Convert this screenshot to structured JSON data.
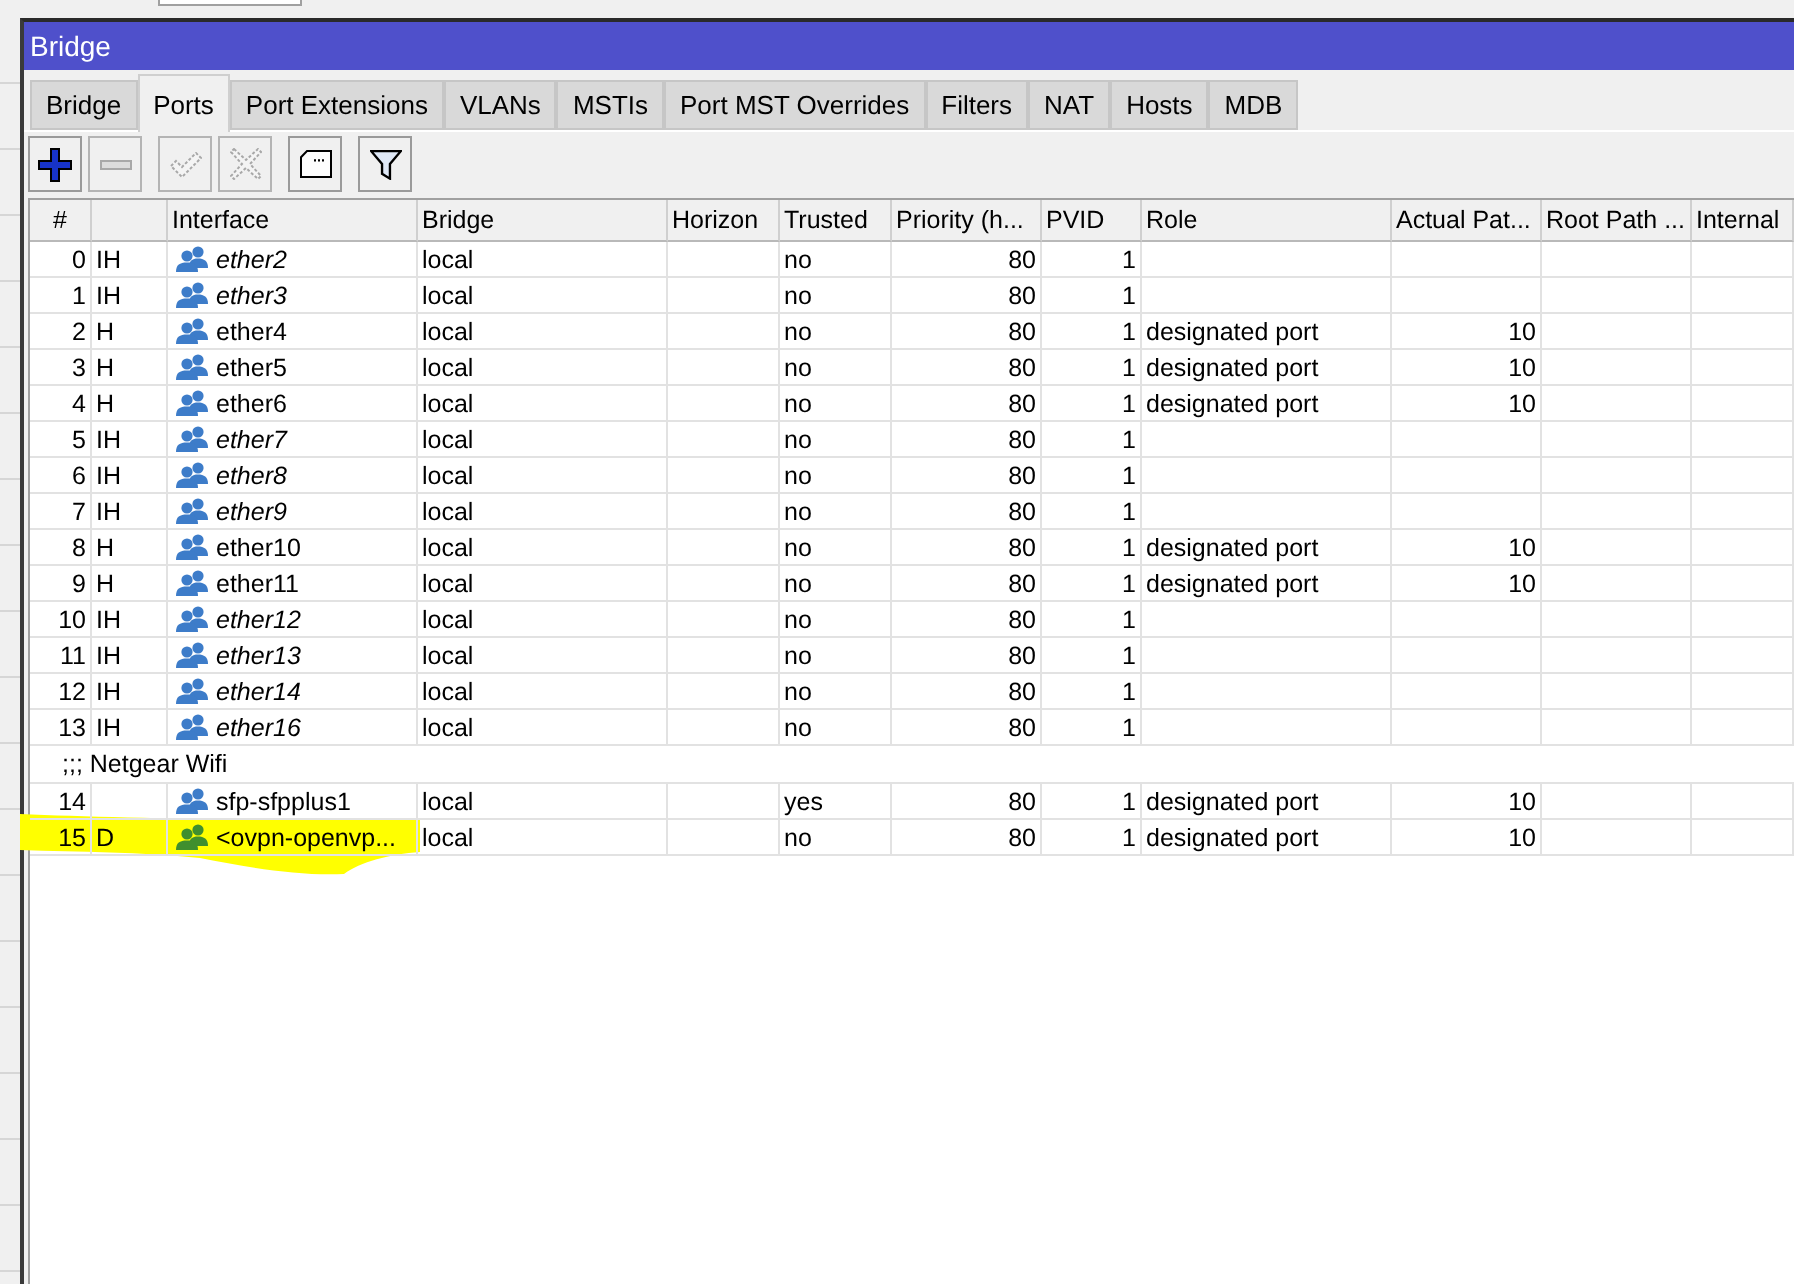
{
  "window": {
    "title": "Bridge"
  },
  "tabs": [
    {
      "label": "Bridge",
      "selected": false
    },
    {
      "label": "Ports",
      "selected": true
    },
    {
      "label": "Port Extensions",
      "selected": false
    },
    {
      "label": "VLANs",
      "selected": false
    },
    {
      "label": "MSTIs",
      "selected": false
    },
    {
      "label": "Port MST Overrides",
      "selected": false
    },
    {
      "label": "Filters",
      "selected": false
    },
    {
      "label": "NAT",
      "selected": false
    },
    {
      "label": "Hosts",
      "selected": false
    },
    {
      "label": "MDB",
      "selected": false
    }
  ],
  "toolbar": [
    [
      {
        "kind": "add",
        "disabled": false
      },
      {
        "kind": "remove",
        "disabled": true
      }
    ],
    [
      {
        "kind": "enable",
        "disabled": true
      },
      {
        "kind": "disable",
        "disabled": true
      }
    ],
    [
      {
        "kind": "comment",
        "disabled": false
      }
    ],
    [
      {
        "kind": "filter",
        "disabled": false
      }
    ]
  ],
  "table": {
    "columns": [
      "#",
      "Interface",
      "Bridge",
      "Horizon",
      "Trusted",
      "Priority (h...",
      "PVID",
      "Role",
      "Actual Pat...",
      "Root Path ...",
      "Internal"
    ],
    "rows": [
      {
        "kind": "port",
        "number": "0",
        "flags": "IH",
        "interface": "ether2",
        "inactive": true,
        "color": "#3d7cc9",
        "bridge": "local",
        "trusted": "no",
        "priority": "80",
        "pvid": "1",
        "highlighted": false
      },
      {
        "kind": "port",
        "number": "1",
        "flags": "IH",
        "interface": "ether3",
        "inactive": true,
        "color": "#3d7cc9",
        "bridge": "local",
        "trusted": "no",
        "priority": "80",
        "pvid": "1",
        "highlighted": false
      },
      {
        "kind": "port",
        "number": "2",
        "flags": "H",
        "interface": "ether4",
        "inactive": false,
        "color": "#3d7cc9",
        "bridge": "local",
        "trusted": "no",
        "priority": "80",
        "pvid": "1",
        "role": "designated port",
        "actual_path": "10",
        "highlighted": false
      },
      {
        "kind": "port",
        "number": "3",
        "flags": "H",
        "interface": "ether5",
        "inactive": false,
        "color": "#3d7cc9",
        "bridge": "local",
        "trusted": "no",
        "priority": "80",
        "pvid": "1",
        "role": "designated port",
        "actual_path": "10",
        "highlighted": false
      },
      {
        "kind": "port",
        "number": "4",
        "flags": "H",
        "interface": "ether6",
        "inactive": false,
        "color": "#3d7cc9",
        "bridge": "local",
        "trusted": "no",
        "priority": "80",
        "pvid": "1",
        "role": "designated port",
        "actual_path": "10",
        "highlighted": false
      },
      {
        "kind": "port",
        "number": "5",
        "flags": "IH",
        "interface": "ether7",
        "inactive": true,
        "color": "#3d7cc9",
        "bridge": "local",
        "trusted": "no",
        "priority": "80",
        "pvid": "1",
        "highlighted": false
      },
      {
        "kind": "port",
        "number": "6",
        "flags": "IH",
        "interface": "ether8",
        "inactive": true,
        "color": "#3d7cc9",
        "bridge": "local",
        "trusted": "no",
        "priority": "80",
        "pvid": "1",
        "highlighted": false
      },
      {
        "kind": "port",
        "number": "7",
        "flags": "IH",
        "interface": "ether9",
        "inactive": true,
        "color": "#3d7cc9",
        "bridge": "local",
        "trusted": "no",
        "priority": "80",
        "pvid": "1",
        "highlighted": false
      },
      {
        "kind": "port",
        "number": "8",
        "flags": "H",
        "interface": "ether10",
        "inactive": false,
        "color": "#3d7cc9",
        "bridge": "local",
        "trusted": "no",
        "priority": "80",
        "pvid": "1",
        "role": "designated port",
        "actual_path": "10",
        "highlighted": false
      },
      {
        "kind": "port",
        "number": "9",
        "flags": "H",
        "interface": "ether11",
        "inactive": false,
        "color": "#3d7cc9",
        "bridge": "local",
        "trusted": "no",
        "priority": "80",
        "pvid": "1",
        "role": "designated port",
        "actual_path": "10",
        "highlighted": false
      },
      {
        "kind": "port",
        "number": "10",
        "flags": "IH",
        "interface": "ether12",
        "inactive": true,
        "color": "#3d7cc9",
        "bridge": "local",
        "trusted": "no",
        "priority": "80",
        "pvid": "1",
        "highlighted": false
      },
      {
        "kind": "port",
        "number": "11",
        "flags": "IH",
        "interface": "ether13",
        "inactive": true,
        "color": "#3d7cc9",
        "bridge": "local",
        "trusted": "no",
        "priority": "80",
        "pvid": "1",
        "highlighted": false
      },
      {
        "kind": "port",
        "number": "12",
        "flags": "IH",
        "interface": "ether14",
        "inactive": true,
        "color": "#3d7cc9",
        "bridge": "local",
        "trusted": "no",
        "priority": "80",
        "pvid": "1",
        "highlighted": false
      },
      {
        "kind": "port",
        "number": "13",
        "flags": "IH",
        "interface": "ether16",
        "inactive": true,
        "color": "#3d7cc9",
        "bridge": "local",
        "trusted": "no",
        "priority": "80",
        "pvid": "1",
        "highlighted": false
      },
      {
        "kind": "comment",
        "text": ";;; Netgear Wifi"
      },
      {
        "kind": "port",
        "number": "14",
        "interface": "sfp-sfpplus1",
        "inactive": false,
        "color": "#3d7cc9",
        "bridge": "local",
        "trusted": "yes",
        "priority": "80",
        "pvid": "1",
        "role": "designated port",
        "actual_path": "10",
        "highlighted": false
      },
      {
        "kind": "port",
        "number": "15",
        "flags": "D",
        "interface": "<ovpn-openvp...",
        "inactive": false,
        "color": "#3f8f2e",
        "bridge": "local",
        "trusted": "no",
        "priority": "80",
        "pvid": "1",
        "role": "designated port",
        "actual_path": "10",
        "highlighted": true
      }
    ]
  }
}
